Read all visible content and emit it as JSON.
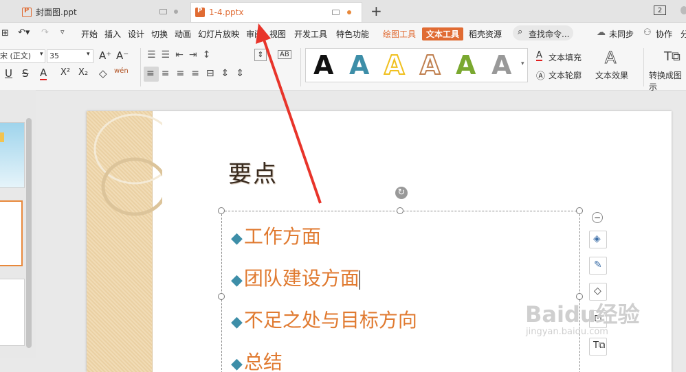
{
  "tabs": [
    {
      "label": "封面图.ppt",
      "active": false
    },
    {
      "label": "1-4.pptx",
      "active": true
    }
  ],
  "tab_count_badge": "2",
  "menu": {
    "items": [
      "开始",
      "插入",
      "设计",
      "切换",
      "动画",
      "幻灯片放映",
      "审阅",
      "视图",
      "开发工具",
      "特色功能"
    ],
    "drawing_tools": "绘图工具",
    "text_tools": "文本工具",
    "resources": "稻壳资源",
    "search_placeholder": "查找命令...",
    "sync": "未同步",
    "collaborate": "协作",
    "share": "分"
  },
  "ribbon": {
    "font_name": "宋 (正文)",
    "font_size": "35",
    "grow_font": "A⁺",
    "shrink_font": "A⁻",
    "underline": "U",
    "strike": "S",
    "font_color": "A",
    "superscript": "X²",
    "subscript": "X₂",
    "clear": "◇",
    "pinyin": "wén",
    "ab_label": "AB",
    "text_fill": "文本填充",
    "text_outline": "文本轮廓",
    "text_effect": "文本效果",
    "convert_label": "转换成图示",
    "gallery_letter": "A"
  },
  "gallery_colors": [
    "#111111",
    "#3d8ea8",
    "#f0c020",
    "#e8d8c0",
    "#7aa830",
    "#888888"
  ],
  "slide": {
    "title": "要点",
    "bullets": [
      "工作方面",
      "团队建设方面",
      "不足之处与目标方向",
      "总结"
    ],
    "bullet_symbol": "◆"
  },
  "watermark": {
    "text": "Baidu经验",
    "url": "jingyan.baidu.com"
  },
  "colors": {
    "accent": "#e06b33",
    "bullet_text": "#e07a30",
    "bullet_marker": "#3d8ea8",
    "arrow": "#e8342a"
  }
}
